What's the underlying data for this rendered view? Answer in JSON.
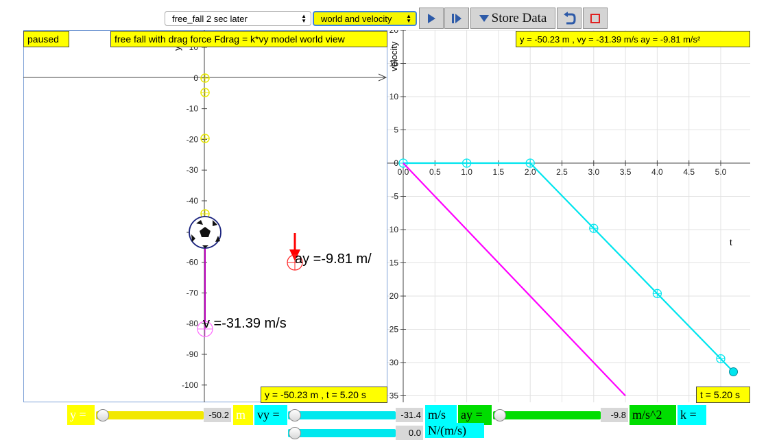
{
  "toolbar": {
    "model_select": "free_fall 2 sec later",
    "view_select": "world and velocity",
    "store_label": "Store Data",
    "play": "play-icon",
    "step": "step-icon",
    "reset": "reset-icon",
    "stop": "stop-icon"
  },
  "world": {
    "status": "paused",
    "title": "free fall with drag force Fdrag = k*vy model world view",
    "readout": "y = -50.23 m , t = 5.20 s",
    "y_axis_label": "y",
    "ticks": [
      "10",
      "0",
      "-10",
      "-20",
      "-30",
      "-40",
      "-50",
      "-60",
      "-70",
      "-80",
      "-90",
      "-100"
    ],
    "accel_label": "ay =-9.81 m/",
    "vel_label": "v =-31.39 m/s",
    "ball": "soccer-ball-icon",
    "colors": {
      "trail": "#e8e800",
      "velocity": "#bb00bb",
      "accel": "#ff0000"
    }
  },
  "graph": {
    "readout": "y = -50.23 m , vy = -31.39 m/s ay = -9.81 m/s²",
    "time_readout": "t = 5.20 s",
    "ylabel": "velocity",
    "xlabel": "t",
    "colors": {
      "vy": "#00e5ee",
      "ay": "#ff00ff"
    }
  },
  "chart_data": {
    "type": "line",
    "xlabel": "t",
    "ylabel": "velocity",
    "xlim": [
      0,
      5.6
    ],
    "ylim": [
      -35,
      20
    ],
    "x_ticks": [
      "0.0",
      "0.5",
      "1.0",
      "1.5",
      "2.0",
      "2.5",
      "3.0",
      "3.5",
      "4.0",
      "4.5",
      "5.0"
    ],
    "y_ticks": [
      {
        "v": 20,
        "t": "20"
      },
      {
        "v": 15,
        "t": "15"
      },
      {
        "v": 10,
        "t": "10"
      },
      {
        "v": 5,
        "t": "5"
      },
      {
        "v": 0,
        "t": "0"
      },
      {
        "v": -5,
        "t": "-5"
      },
      {
        "v": -10,
        "t": "10"
      },
      {
        "v": -15,
        "t": "15"
      },
      {
        "v": -20,
        "t": "20"
      },
      {
        "v": -25,
        "t": "25"
      },
      {
        "v": -30,
        "t": "30"
      },
      {
        "v": -35,
        "t": "35"
      }
    ],
    "series": [
      {
        "color": "#00e5ee",
        "points": [
          [
            0,
            0
          ],
          [
            1,
            0
          ],
          [
            2,
            0
          ],
          [
            3,
            -9.81
          ],
          [
            4,
            -19.62
          ],
          [
            5,
            -29.43
          ],
          [
            5.2,
            -31.39
          ]
        ]
      },
      {
        "color": "#ff00ff",
        "points": [
          [
            0,
            0
          ],
          [
            3.5,
            -35
          ]
        ]
      }
    ]
  },
  "controls": {
    "y_label": "y =",
    "y_value": "-50.2",
    "y_unit": "m",
    "vy_label": "vy =",
    "vy_value": "-31.4",
    "vy_unit": "m/s",
    "ay_label": "ay =",
    "ay_value": "-9.8",
    "ay_unit": "m/s^2",
    "k_label": "k =",
    "k_value": "0.0",
    "k_unit": "N/(m/s)",
    "slider_levels": {
      "y": 0.0,
      "vy": 0.0,
      "ay": 0.0,
      "k": 0.0
    }
  }
}
